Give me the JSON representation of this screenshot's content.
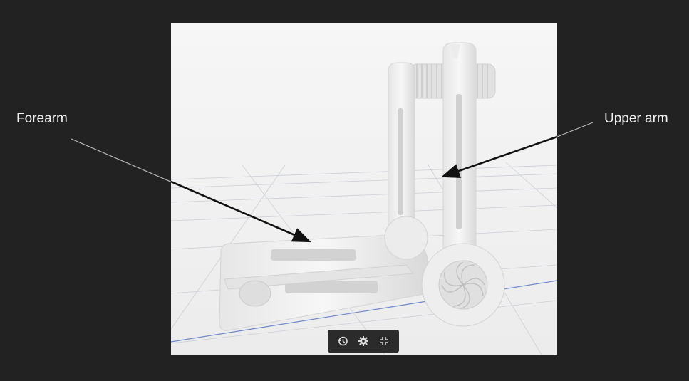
{
  "annotations": {
    "forearm_label": "Forearm",
    "upper_arm_label": "Upper arm"
  },
  "viewer": {
    "background_color": "#f1f1f1",
    "model_color": "#eeeeee",
    "toolbar": {
      "buttons": [
        {
          "icon": "history-icon"
        },
        {
          "icon": "gear-icon"
        },
        {
          "icon": "collapse-icon"
        }
      ]
    }
  },
  "colors": {
    "page_background": "#222222",
    "label_text": "#f2f2f2",
    "arrow": "#111111",
    "toolbar_background": "#2b2b2b",
    "toolbar_icon": "#dddddd"
  }
}
